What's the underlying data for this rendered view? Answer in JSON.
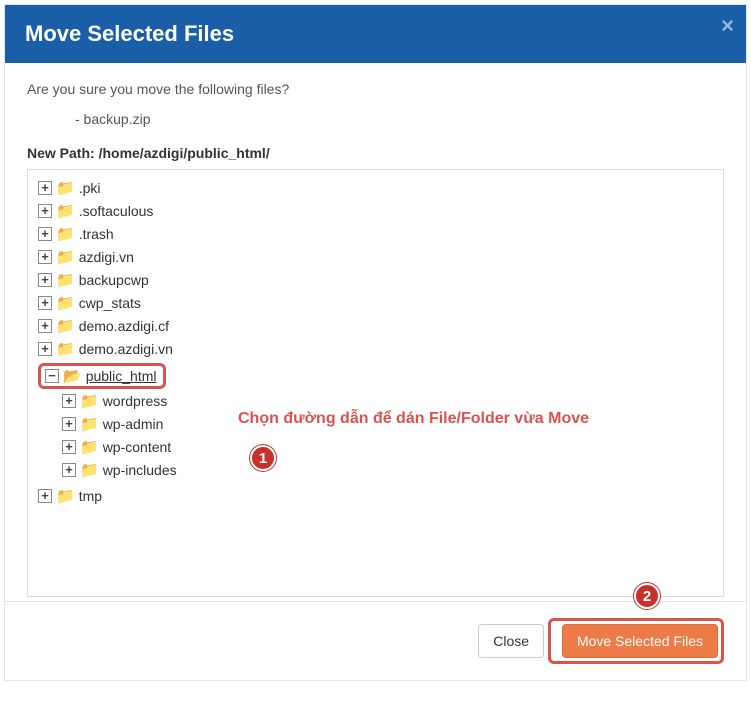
{
  "header": {
    "title": "Move Selected Files",
    "close_glyph": "×"
  },
  "body": {
    "question": "Are you sure you move the following files?",
    "files": [
      "- backup.zip"
    ],
    "path_label_prefix": "New Path: ",
    "path_value": "/home/azdigi/public_html/"
  },
  "tree": {
    "root": [
      {
        "name": ".pki",
        "expanded": false
      },
      {
        "name": ".softaculous",
        "expanded": false
      },
      {
        "name": ".trash",
        "expanded": false
      },
      {
        "name": "azdigi.vn",
        "expanded": false
      },
      {
        "name": "backupcwp",
        "expanded": false
      },
      {
        "name": "cwp_stats",
        "expanded": false
      },
      {
        "name": "demo.azdigi.cf",
        "expanded": false
      },
      {
        "name": "demo.azdigi.vn",
        "expanded": false
      },
      {
        "name": "public_html",
        "expanded": true,
        "selected": true,
        "children": [
          {
            "name": "wordpress",
            "expanded": false
          },
          {
            "name": "wp-admin",
            "expanded": false
          },
          {
            "name": "wp-content",
            "expanded": false
          },
          {
            "name": "wp-includes",
            "expanded": false
          }
        ]
      },
      {
        "name": "tmp",
        "expanded": false
      }
    ]
  },
  "annotations": {
    "hint": "Chọn đường dẫn để dán File/Folder vừa Move",
    "marker1": "1",
    "marker2": "2"
  },
  "footer": {
    "close_label": "Close",
    "move_label": "Move Selected Files"
  },
  "glyphs": {
    "plus": "+",
    "minus": "−",
    "folder": "📁",
    "folder_open": "📂"
  }
}
